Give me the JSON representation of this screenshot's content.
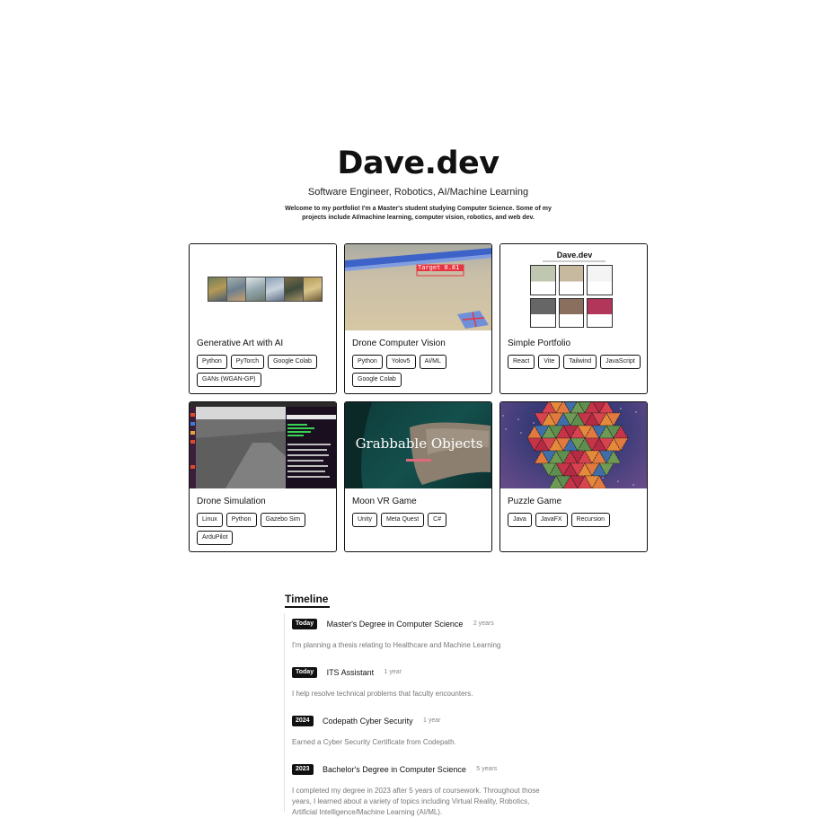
{
  "header": {
    "title": "Dave.dev",
    "subtitle": "Software Engineer, Robotics, AI/Machine Learning",
    "intro": "Welcome to my portfolio! I'm a Master's student studying Computer Science. Some of my projects include AI/machine learning, computer vision, robotics, and web dev."
  },
  "projects": [
    {
      "title": "Generative Art with AI",
      "tags": [
        "Python",
        "PyTorch",
        "Google Colab",
        "GANs (WGAN-GP)"
      ],
      "thumbnail": "generative-art-strip"
    },
    {
      "title": "Drone Computer Vision",
      "tags": [
        "Python",
        "Yolov5",
        "AI/ML",
        "Google Colab"
      ],
      "thumbnail": "drone-vision-frame",
      "overlay_text": "Target 0.81"
    },
    {
      "title": "Simple Portfolio",
      "tags": [
        "React",
        "Vite",
        "Tailwind",
        "JavaScript"
      ],
      "thumbnail": "portfolio-screenshot",
      "overlay_text": "Dave.dev"
    },
    {
      "title": "Drone Simulation",
      "tags": [
        "Linux",
        "Python",
        "Gazebo Sim",
        "ArduPilot"
      ],
      "thumbnail": "simulation-desktop"
    },
    {
      "title": "Moon VR Game",
      "tags": [
        "Unity",
        "Meta Quest",
        "C#"
      ],
      "thumbnail": "vr-game-scene",
      "overlay_text": "Grabbable Objects"
    },
    {
      "title": "Puzzle Game",
      "tags": [
        "Java",
        "JavaFX",
        "Recursion"
      ],
      "thumbnail": "triangle-puzzle"
    }
  ],
  "timeline": {
    "heading": "Timeline",
    "items": [
      {
        "badge": "Today",
        "title": "Master's Degree in Computer Science",
        "duration": "2 years",
        "description": "I'm planning a thesis relating to Healthcare and Machine Learning"
      },
      {
        "badge": "Today",
        "title": "ITS Assistant",
        "duration": "1 year",
        "description": "I help resolve technical problems that faculty encounters."
      },
      {
        "badge": "2024",
        "title": "Codepath Cyber Security",
        "duration": "1 year",
        "description": "Earned a Cyber Security Certificate from Codepath."
      },
      {
        "badge": "2023",
        "title": "Bachelor's Degree in Computer Science",
        "duration": "5 years",
        "description": "I completed my degree in 2023 after 5 years of coursework. Throughout those years, I learned about a variety of topics including Virtual Reality, Robotics, Artificial Intelligence/Machine Learning (AI/ML)."
      }
    ]
  },
  "colors": {
    "accent": "#111111",
    "muted_text": "#777777",
    "timeline_line": "#e0e0e0",
    "moon_underline": "#e06a7a",
    "target_box": "#e8343f"
  }
}
